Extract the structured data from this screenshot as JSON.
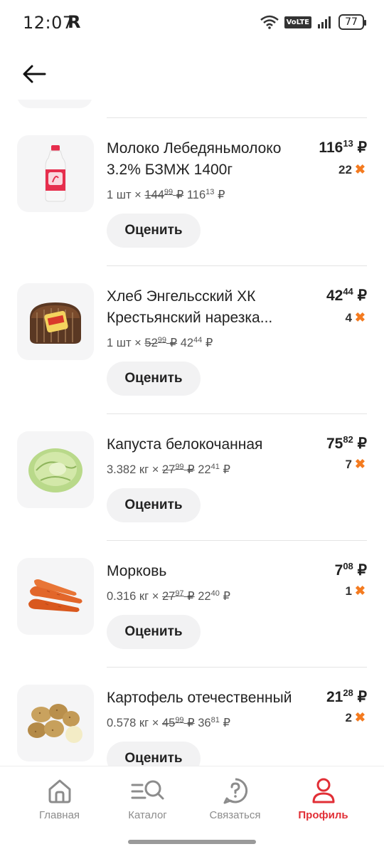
{
  "status": {
    "time": "12:07",
    "carrier_icon": "R",
    "volte": "VoLTE",
    "battery": "77"
  },
  "products": [
    {
      "name_line1": "Молоко Лебедяньмолоко",
      "name_line2": "3.2% БЗМЖ 1400г",
      "quantity": "1 шт",
      "old_price_int": "144",
      "old_price_frac": "99",
      "unit_price_int": "116",
      "unit_price_frac": "13",
      "total_int": "116",
      "total_frac": "13",
      "bonus": "22",
      "rate_label": "Оценить",
      "image": "milk-bottle"
    },
    {
      "name_line1": "Хлеб Энгельсский ХК",
      "name_line2": "Крестьянский нарезка...",
      "quantity": "1 шт",
      "old_price_int": "52",
      "old_price_frac": "99",
      "unit_price_int": "42",
      "unit_price_frac": "44",
      "total_int": "42",
      "total_frac": "44",
      "bonus": "4",
      "rate_label": "Оценить",
      "image": "bread-loaf"
    },
    {
      "name_line1": "Капуста белокочанная",
      "name_line2": "",
      "quantity": "3.382 кг",
      "old_price_int": "27",
      "old_price_frac": "99",
      "unit_price_int": "22",
      "unit_price_frac": "41",
      "total_int": "75",
      "total_frac": "82",
      "bonus": "7",
      "rate_label": "Оценить",
      "image": "cabbage"
    },
    {
      "name_line1": "Морковь",
      "name_line2": "",
      "quantity": "0.316 кг",
      "old_price_int": "27",
      "old_price_frac": "97",
      "unit_price_int": "22",
      "unit_price_frac": "40",
      "total_int": "7",
      "total_frac": "08",
      "bonus": "1",
      "rate_label": "Оценить",
      "image": "carrots"
    },
    {
      "name_line1": "Картофель отечественный",
      "name_line2": "",
      "quantity": "0.578 кг",
      "old_price_int": "45",
      "old_price_frac": "99",
      "unit_price_int": "36",
      "unit_price_frac": "81",
      "total_int": "21",
      "total_frac": "28",
      "bonus": "2",
      "rate_label": "Оценить",
      "image": "potatoes"
    }
  ],
  "currency": "₽",
  "times": "×",
  "bonus_mark": "✖",
  "nav": [
    {
      "label": "Главная",
      "icon": "home-icon"
    },
    {
      "label": "Каталог",
      "icon": "catalog-search-icon"
    },
    {
      "label": "Связаться",
      "icon": "question-chat-icon"
    },
    {
      "label": "Профиль",
      "icon": "profile-icon",
      "active": true
    }
  ],
  "colors": {
    "accent": "#e12f36",
    "bonus": "#f47b20",
    "nav_inactive": "#8c8c8c"
  }
}
